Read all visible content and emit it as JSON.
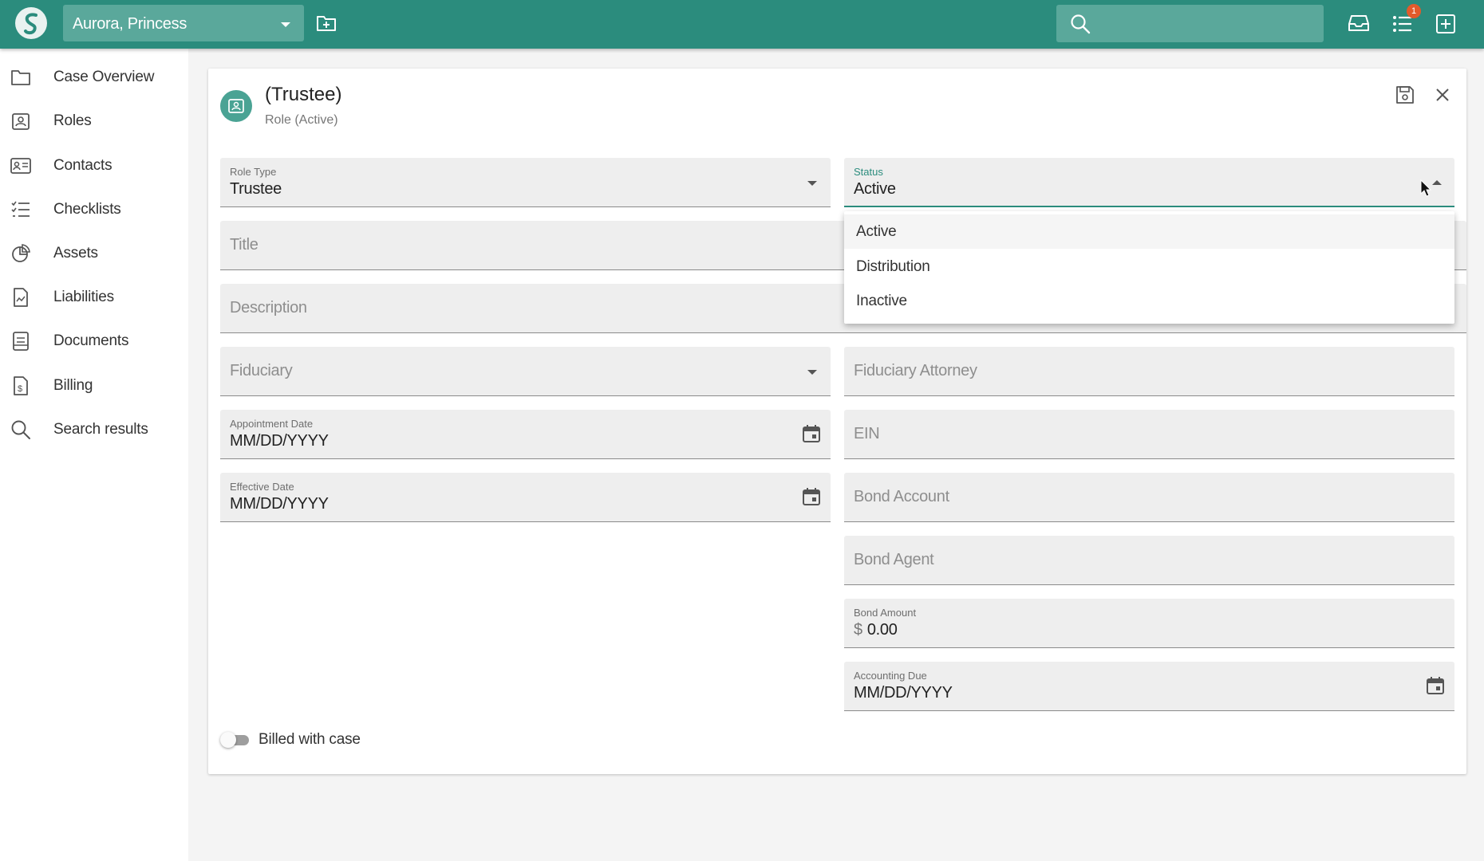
{
  "header": {
    "case_name": "Aurora, Princess",
    "search_placeholder": "",
    "notification_count": "1",
    "icons": [
      "logo",
      "new-folder-icon",
      "search-icon",
      "inbox-icon",
      "tasks-icon",
      "add-icon"
    ]
  },
  "sidebar": {
    "items": [
      {
        "label": "Case Overview",
        "icon": "folder-icon"
      },
      {
        "label": "Roles",
        "icon": "role-badge-icon"
      },
      {
        "label": "Contacts",
        "icon": "contact-card-icon"
      },
      {
        "label": "Checklists",
        "icon": "checklist-icon"
      },
      {
        "label": "Assets",
        "icon": "pie-chart-icon"
      },
      {
        "label": "Liabilities",
        "icon": "liabilities-doc-icon"
      },
      {
        "label": "Documents",
        "icon": "document-icon"
      },
      {
        "label": "Billing",
        "icon": "billing-icon"
      },
      {
        "label": "Search results",
        "icon": "search-icon"
      }
    ]
  },
  "role": {
    "title": "(Trustee)",
    "subtitle": "Role (Active)"
  },
  "form": {
    "role_type": {
      "label": "Role Type",
      "value": "Trustee"
    },
    "status": {
      "label": "Status",
      "value": "Active",
      "options": [
        "Active",
        "Distribution",
        "Inactive"
      ]
    },
    "title": {
      "placeholder": "Title"
    },
    "description": {
      "placeholder": "Description"
    },
    "fiduciary": {
      "placeholder": "Fiduciary"
    },
    "fiduciary_attorney": {
      "placeholder": "Fiduciary Attorney"
    },
    "appointment_date": {
      "label": "Appointment Date",
      "value": "MM/DD/YYYY"
    },
    "ein": {
      "placeholder": "EIN"
    },
    "effective_date": {
      "label": "Effective Date",
      "value": "MM/DD/YYYY"
    },
    "bond_account": {
      "placeholder": "Bond Account"
    },
    "bond_agent": {
      "placeholder": "Bond Agent"
    },
    "bond_amount": {
      "label": "Bond Amount",
      "currency": "$",
      "value": "0.00"
    },
    "accounting_due": {
      "label": "Accounting Due",
      "value": "MM/DD/YYYY"
    },
    "billed_with_case": {
      "label": "Billed with case",
      "checked": false
    }
  },
  "colors": {
    "primary": "#2b8c7d",
    "topbar_input": "#5aa89b",
    "badge": "#e25a2b"
  }
}
